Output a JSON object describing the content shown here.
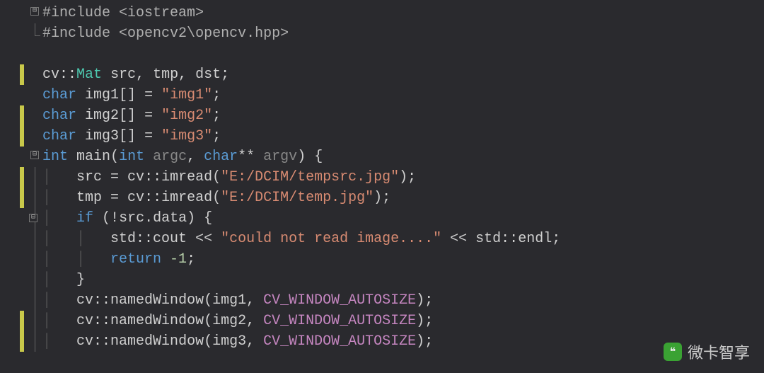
{
  "tokens": {
    "hash_include": "#include",
    "hdr_iostream_open": "<",
    "hdr_iostream": "iostream",
    "hdr_iostream_close": ">",
    "hdr_cv_open": "<",
    "hdr_cv": "opencv2\\opencv.hpp",
    "hdr_cv_close": ">",
    "cv": "cv",
    "dcolon": "::",
    "Mat": "Mat",
    "src": "src",
    "tmp": "tmp",
    "dst": "dst",
    "comma_sp": ", ",
    "semicolon": ";",
    "char": "char",
    "img1": "img1",
    "img2": "img2",
    "img3": "img3",
    "brackets": "[]",
    "eq": " = ",
    "str_img1": "\"img1\"",
    "str_img2": "\"img2\"",
    "str_img3": "\"img3\"",
    "int": "int",
    "main": "main",
    "lparen": "(",
    "rparen": ")",
    "argc": "argc",
    "starstar": "**",
    "argv": "argv",
    "lbrace": " {",
    "rbrace": "}",
    "imread": "imread",
    "str_path1": "\"E:/DCIM/tempsrc.jpg\"",
    "str_path2": "\"E:/DCIM/temp.jpg\"",
    "if": "if",
    "bang": "!",
    "dot": ".",
    "data": "data",
    "std": "std",
    "cout": "cout",
    "lshift": " << ",
    "str_err": "\"could not read image....\"",
    "endl": "endl",
    "return": "return",
    "neg1": "-1",
    "namedWindow": "namedWindow",
    "cv_win": "CV_WINDOW_AUTOSIZE",
    "fold_minus": "⊟"
  },
  "watermark": {
    "text": "微卡智享",
    "icon": "❝"
  }
}
